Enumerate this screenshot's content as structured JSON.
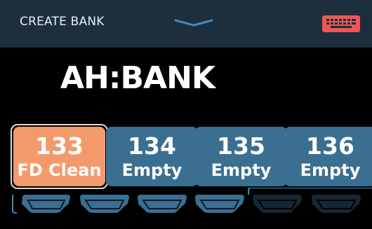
{
  "header": {
    "title": "CREATE BANK",
    "keyboard_icon": "keyboard-icon",
    "handle_icon": "chevron-down-icon",
    "accent": "#ee5756",
    "background": "#1d2e3c"
  },
  "bank": {
    "name": "AH:BANK"
  },
  "patches": [
    {
      "number": "133",
      "name": "FD Clean",
      "selected": true,
      "color": "#f39a6d"
    },
    {
      "number": "134",
      "name": "Empty",
      "selected": false,
      "color": "#3a6f92"
    },
    {
      "number": "135",
      "name": "Empty",
      "selected": false,
      "color": "#3a6f92"
    },
    {
      "number": "136",
      "name": "Empty",
      "selected": false,
      "color": "#3a6f92"
    }
  ],
  "footswitch_icon": "footswitch-icon",
  "footswitch_count": 6
}
